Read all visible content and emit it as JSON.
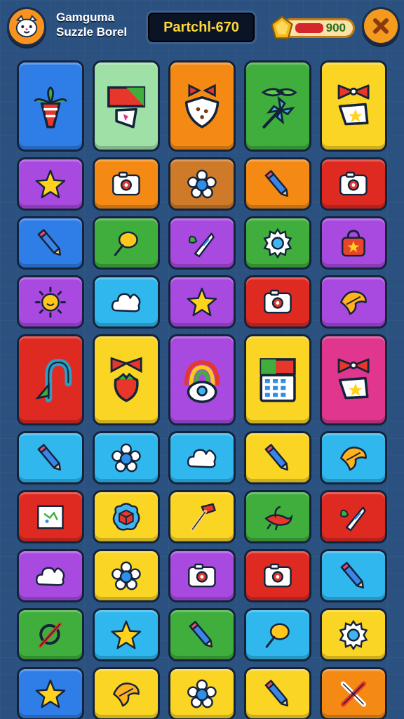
{
  "header": {
    "title_line1": "Gamguma",
    "title_line2": "Suzzle Borel",
    "score_text": "Partchl-670",
    "coins_value": "900",
    "coin_level": 0.4
  },
  "colors": {
    "background": "#2a5180",
    "blue": "#2f7ee8",
    "mint": "#9ee0a6",
    "orange": "#f48a14",
    "green": "#3fae3c",
    "yellow": "#fad524",
    "purple": "#a84ae0",
    "brown": "#cf7a28",
    "red": "#df2a22",
    "cyan": "#2fb7ee",
    "magenta": "#e0368e"
  },
  "rows": [
    {
      "tall": true,
      "tiles": [
        {
          "color": "blue",
          "icon": "carrot-icon"
        },
        {
          "color": "mint",
          "icon": "flag-icon"
        },
        {
          "color": "orange",
          "icon": "shield-icon"
        },
        {
          "color": "green",
          "icon": "pinwheel-icon"
        },
        {
          "color": "yellow",
          "icon": "bow-flag-icon"
        }
      ]
    },
    {
      "tall": false,
      "tiles": [
        {
          "color": "purple",
          "icon": "star-icon"
        },
        {
          "color": "orange",
          "icon": "camera-icon"
        },
        {
          "color": "brown",
          "icon": "flower-icon"
        },
        {
          "color": "orange",
          "icon": "pencil-icon"
        },
        {
          "color": "red",
          "icon": "camera-icon"
        }
      ]
    },
    {
      "tall": false,
      "tiles": [
        {
          "color": "blue",
          "icon": "pencil-icon"
        },
        {
          "color": "green",
          "icon": "balloon-icon"
        },
        {
          "color": "purple",
          "icon": "leaf-cone-icon"
        },
        {
          "color": "green",
          "icon": "gear-icon"
        },
        {
          "color": "purple",
          "icon": "bag-icon"
        }
      ]
    },
    {
      "tall": false,
      "tiles": [
        {
          "color": "purple",
          "icon": "sun-icon"
        },
        {
          "color": "cyan",
          "icon": "cloud-icon"
        },
        {
          "color": "purple",
          "icon": "star-icon"
        },
        {
          "color": "red",
          "icon": "camera-icon"
        },
        {
          "color": "purple",
          "icon": "leaf-icon"
        }
      ]
    },
    {
      "tall": true,
      "tiles": [
        {
          "color": "red",
          "icon": "hook-icon"
        },
        {
          "color": "yellow",
          "icon": "strawberry-icon"
        },
        {
          "color": "purple",
          "icon": "rainbow-icon"
        },
        {
          "color": "yellow",
          "icon": "calculator-icon"
        },
        {
          "color": "magenta",
          "icon": "bow-flag-icon"
        }
      ]
    },
    {
      "tall": false,
      "tiles": [
        {
          "color": "cyan",
          "icon": "pencil-icon"
        },
        {
          "color": "cyan",
          "icon": "flower-icon"
        },
        {
          "color": "cyan",
          "icon": "cloud-icon"
        },
        {
          "color": "yellow",
          "icon": "pencil-icon"
        },
        {
          "color": "cyan",
          "icon": "leaf-icon"
        }
      ]
    },
    {
      "tall": false,
      "tiles": [
        {
          "color": "red",
          "icon": "map-icon"
        },
        {
          "color": "yellow",
          "icon": "cube-icon"
        },
        {
          "color": "yellow",
          "icon": "hammer-icon"
        },
        {
          "color": "green",
          "icon": "bird-icon"
        },
        {
          "color": "red",
          "icon": "leaf-cone-icon"
        }
      ]
    },
    {
      "tall": false,
      "tiles": [
        {
          "color": "purple",
          "icon": "cloud-icon"
        },
        {
          "color": "yellow",
          "icon": "flower-icon"
        },
        {
          "color": "purple",
          "icon": "camera-icon"
        },
        {
          "color": "red",
          "icon": "camera-icon"
        },
        {
          "color": "cyan",
          "icon": "pencil-icon"
        }
      ]
    },
    {
      "tall": false,
      "tiles": [
        {
          "color": "green",
          "icon": "wrench-icon"
        },
        {
          "color": "cyan",
          "icon": "star-icon"
        },
        {
          "color": "green",
          "icon": "pencil-icon"
        },
        {
          "color": "cyan",
          "icon": "balloon-icon"
        },
        {
          "color": "yellow",
          "icon": "gear-icon"
        }
      ]
    },
    {
      "tall": false,
      "tiles": [
        {
          "color": "blue",
          "icon": "star-icon"
        },
        {
          "color": "yellow",
          "icon": "leaf-icon"
        },
        {
          "color": "yellow",
          "icon": "flower-icon"
        },
        {
          "color": "yellow",
          "icon": "pencil-icon"
        },
        {
          "color": "orange",
          "icon": "cross-icon"
        }
      ]
    }
  ]
}
